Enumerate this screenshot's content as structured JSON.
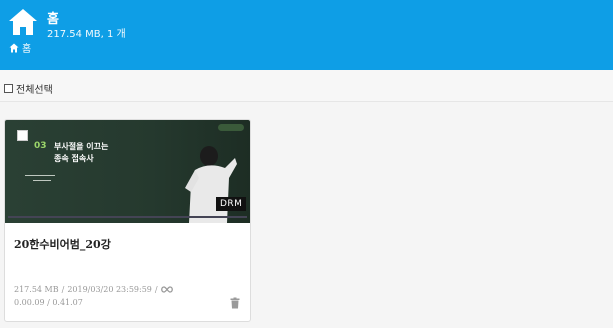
{
  "header": {
    "title": "홈",
    "subtitle": "217.54 MB, 1 개",
    "breadcrumb": "홈"
  },
  "toolbar": {
    "select_all_label": "전체선택"
  },
  "items": [
    {
      "thumbnail": {
        "lecture_number": "03",
        "line1": "부사절을 이끄는",
        "line2": "종속 접속사",
        "badge": "DRM",
        "progress": 0.0
      },
      "title": "20한수비어범_20강",
      "size": "217.54 MB",
      "date": "2019/03/20 23:59:59",
      "separator": "/",
      "playback": "0.00.09 / 0.41.07"
    }
  ],
  "colors": {
    "accent": "#0e9ee6",
    "board": "#25392e"
  }
}
